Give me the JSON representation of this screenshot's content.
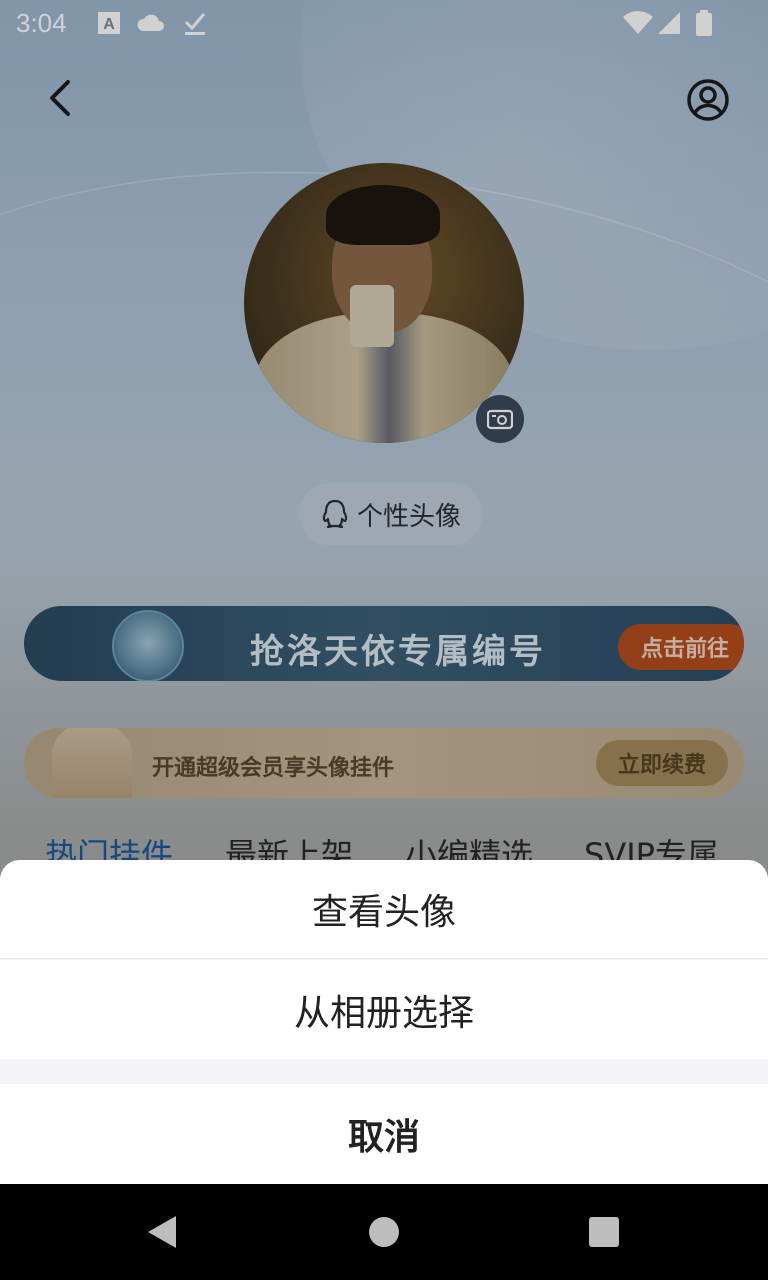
{
  "status_bar": {
    "time": "3:04",
    "icons": [
      "font-a-icon",
      "cloud-icon",
      "download-check-icon",
      "wifi-icon",
      "signal-icon",
      "battery-icon"
    ]
  },
  "header": {
    "back_icon": "chevron-left-icon",
    "profile_icon": "user-circle-icon"
  },
  "avatar": {
    "camera_icon": "camera-icon"
  },
  "personal_avatar": {
    "label": "个性头像",
    "icon": "qq-penguin-icon"
  },
  "promo_banner": {
    "title": "抢洛天依专属编号",
    "cta": "点击前往"
  },
  "vip_banner": {
    "text": "开通超级会员享头像挂件",
    "cta": "立即续费"
  },
  "tabs": [
    {
      "label": "热门挂件",
      "active": true
    },
    {
      "label": "最新上架",
      "active": false
    },
    {
      "label": "小编精选",
      "active": false
    },
    {
      "label": "SVIP专属",
      "active": false
    }
  ],
  "action_sheet": {
    "view_avatar": "查看头像",
    "choose_from_album": "从相册选择",
    "cancel": "取消"
  },
  "colors": {
    "tab_active": "#1b5a9e",
    "promo_cta": "#b64d1e",
    "vip_cta": "#a58a5f"
  }
}
